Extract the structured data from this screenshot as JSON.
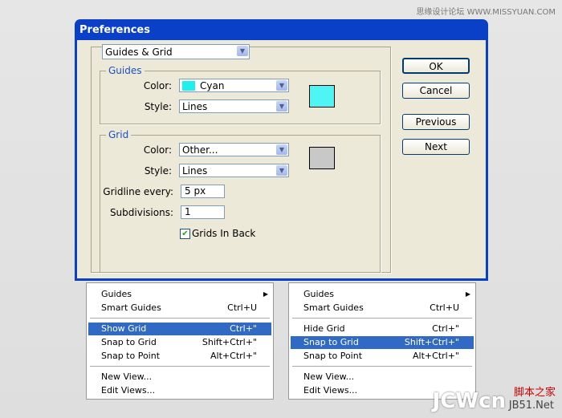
{
  "watermark": {
    "top": "思缘设计论坛 WWW.MISSYUAN.COM",
    "bottom_logo": "JCWcn",
    "bottom_cn": "脚本之家",
    "bottom_site": "JB51.Net"
  },
  "dialog": {
    "title": "Preferences",
    "section": "Guides & Grid",
    "guides": {
      "legend": "Guides",
      "color_label": "Color:",
      "color_value": "Cyan",
      "style_label": "Style:",
      "style_value": "Lines",
      "swatch": "#4ff5f5"
    },
    "grid": {
      "legend": "Grid",
      "color_label": "Color:",
      "color_value": "Other...",
      "style_label": "Style:",
      "style_value": "Lines",
      "gridline_label": "Gridline every:",
      "gridline_value": "5 px",
      "subdiv_label": "Subdivisions:",
      "subdiv_value": "1",
      "back_label": "Grids In Back",
      "back_checked": true,
      "swatch": "#c8c8c8"
    },
    "buttons": {
      "ok": "OK",
      "cancel": "Cancel",
      "previous": "Previous",
      "next": "Next"
    }
  },
  "menus": [
    {
      "items": [
        {
          "label": "Guides",
          "shortcut": ""
        },
        {
          "label": "Smart Guides",
          "shortcut": "Ctrl+U"
        },
        {
          "label": "Show Grid",
          "shortcut": "Ctrl+\""
        },
        {
          "label": "Snap to Grid",
          "shortcut": "Shift+Ctrl+\""
        },
        {
          "label": "Snap to Point",
          "shortcut": "Alt+Ctrl+\""
        },
        {
          "label": "New View...",
          "shortcut": ""
        },
        {
          "label": "Edit Views...",
          "shortcut": ""
        }
      ]
    },
    {
      "items": [
        {
          "label": "Guides",
          "shortcut": ""
        },
        {
          "label": "Smart Guides",
          "shortcut": "Ctrl+U"
        },
        {
          "label": "Hide Grid",
          "shortcut": "Ctrl+\""
        },
        {
          "label": "Snap to Grid",
          "shortcut": "Shift+Ctrl+\""
        },
        {
          "label": "Snap to Point",
          "shortcut": "Alt+Ctrl+\""
        },
        {
          "label": "New View...",
          "shortcut": ""
        },
        {
          "label": "Edit Views...",
          "shortcut": ""
        }
      ]
    }
  ]
}
